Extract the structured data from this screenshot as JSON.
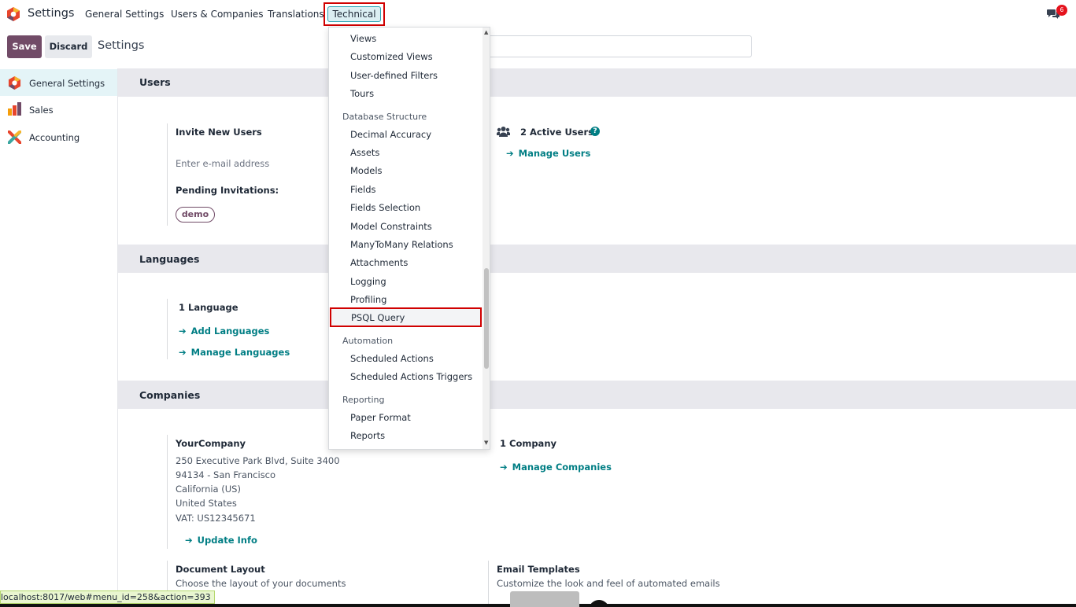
{
  "navbar": {
    "app_name": "Settings",
    "menus": [
      "General Settings",
      "Users & Companies",
      "Translations"
    ],
    "active_menu": "Technical",
    "chat_badge": "6"
  },
  "control_panel": {
    "save_label": "Save",
    "discard_label": "Discard",
    "breadcrumb": "Settings"
  },
  "sidebar": {
    "items": [
      {
        "label": "General Settings"
      },
      {
        "label": "Sales"
      },
      {
        "label": "Accounting"
      }
    ]
  },
  "users": {
    "title": "Users",
    "invite_label": "Invite New Users",
    "email_placeholder": "Enter e-mail address",
    "pending_label": "Pending Invitations:",
    "pending_tag": "demo",
    "active_users": "2 Active Users",
    "manage_users": "Manage Users"
  },
  "languages": {
    "title": "Languages",
    "count": "1 Language",
    "add_link": "Add Languages",
    "manage_link": "Manage Languages"
  },
  "companies": {
    "title": "Companies",
    "company_name": "YourCompany",
    "address_lines": [
      "250 Executive Park Blvd, Suite 3400",
      "94134 - San Francisco",
      "California (US)",
      "United States",
      "VAT:  US12345671"
    ],
    "update_link": "Update Info",
    "count": "1 Company",
    "manage_link": "Manage Companies",
    "doc_layout_title": "Document Layout",
    "doc_layout_desc": "Choose the layout of your documents",
    "email_templates_title": "Email Templates",
    "email_templates_desc": "Customize the look and feel of automated emails"
  },
  "dropdown": {
    "items_top": [
      "Views",
      "Customized Views",
      "User-defined Filters",
      "Tours"
    ],
    "header_db": "Database Structure",
    "items_db": [
      "Decimal Accuracy",
      "Assets",
      "Models",
      "Fields",
      "Fields Selection",
      "Model Constraints",
      "ManyToMany Relations",
      "Attachments",
      "Logging",
      "Profiling"
    ],
    "highlighted": "PSQL Query",
    "header_automation": "Automation",
    "items_automation": [
      "Scheduled Actions",
      "Scheduled Actions Triggers"
    ],
    "header_reporting": "Reporting",
    "items_reporting": [
      "Paper Format",
      "Reports"
    ]
  },
  "status_bar": {
    "url": "localhost:8017/web#menu_id=258&action=393"
  },
  "colors": {
    "brand": "#714b67",
    "link": "#017e84",
    "highlight_border": "#d00000"
  }
}
